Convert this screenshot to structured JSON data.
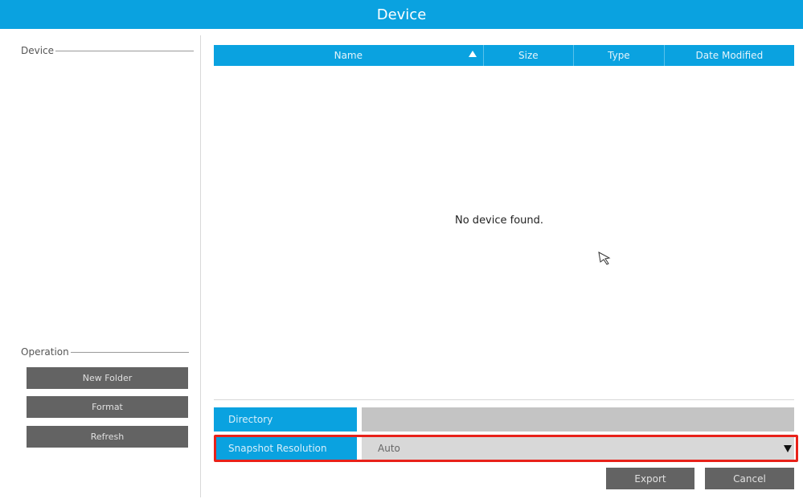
{
  "window": {
    "title": "Device"
  },
  "sidebar": {
    "device_group_label": "Device",
    "operation_group_label": "Operation",
    "buttons": {
      "new_folder": "New Folder",
      "format": "Format",
      "refresh": "Refresh"
    }
  },
  "file_table": {
    "columns": [
      "Name",
      "Size",
      "Type",
      "Date Modified"
    ],
    "sort_column": "Name",
    "sort_direction": "ascending",
    "sort_icon": "triangle-up-icon",
    "empty_message": "No device found."
  },
  "form": {
    "directory": {
      "label": "Directory",
      "value": ""
    },
    "snapshot_resolution": {
      "label": "Snapshot Resolution",
      "value": "Auto",
      "icon": "dropdown-triangle-icon"
    }
  },
  "actions": {
    "export": "Export",
    "cancel": "Cancel"
  },
  "colors": {
    "accent": "#0aa2e0",
    "button": "#636363",
    "highlight": "#e8221a",
    "field": "#c4c4c4"
  }
}
